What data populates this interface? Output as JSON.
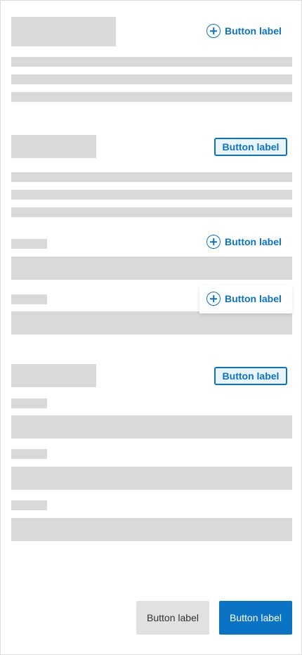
{
  "section1": {
    "add_button_label": "Button label"
  },
  "section2": {
    "header_button_label": "Button label"
  },
  "field1": {
    "add_button_label": "Button label"
  },
  "field2": {
    "add_button_label": "Button label"
  },
  "section3": {
    "header_button_label": "Button label"
  },
  "footer": {
    "secondary_label": "Button label",
    "primary_label": "Button label"
  },
  "colors": {
    "accent": "#0a73c4",
    "placeholder": "#d9d9d9",
    "secondary_button": "#e1e1e1"
  }
}
